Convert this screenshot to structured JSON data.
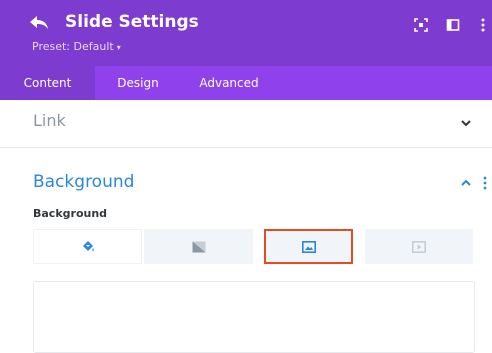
{
  "header": {
    "title": "Slide Settings",
    "preset_label": "Preset: Default",
    "preset_caret": "▾",
    "icons": [
      "back-arrow-icon",
      "expand-icon",
      "split-view-icon",
      "more-vertical-icon"
    ]
  },
  "tabs": [
    {
      "label": "Content",
      "active": true
    },
    {
      "label": "Design",
      "active": false
    },
    {
      "label": "Advanced",
      "active": false
    }
  ],
  "sections": {
    "link": {
      "title": "Link",
      "expanded": false
    },
    "background": {
      "title": "Background",
      "expanded": true,
      "field_label": "Background",
      "options": [
        {
          "icon": "paint-bucket-icon",
          "state": "active"
        },
        {
          "icon": "gradient-icon",
          "state": "default"
        },
        {
          "icon": "image-icon",
          "state": "highlighted"
        },
        {
          "icon": "video-icon",
          "state": "default"
        }
      ]
    }
  },
  "colors": {
    "header_bg": "#7e3bd0",
    "tabs_bg": "#8f42ec",
    "accent_blue": "#2b87da",
    "highlight_outline": "#e54b22"
  }
}
